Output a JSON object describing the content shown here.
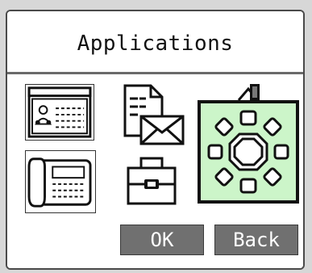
{
  "header": {
    "title": "Applications"
  },
  "apps": [
    {
      "name": "Contacts",
      "icon": "address-book-icon"
    },
    {
      "name": "Messages",
      "icon": "document-envelope-icon"
    },
    {
      "name": "Settings",
      "icon": "gear-icon"
    },
    {
      "name": "Phone",
      "icon": "desk-phone-icon"
    },
    {
      "name": "Tools",
      "icon": "toolbox-icon"
    }
  ],
  "selected_app_index": 2,
  "softkeys": {
    "ok_label": "OK",
    "back_label": "Back"
  },
  "colors": {
    "selection_fill": "#ccf5c9",
    "softkey_fill": "#707070",
    "background": "#d7d7d7"
  }
}
